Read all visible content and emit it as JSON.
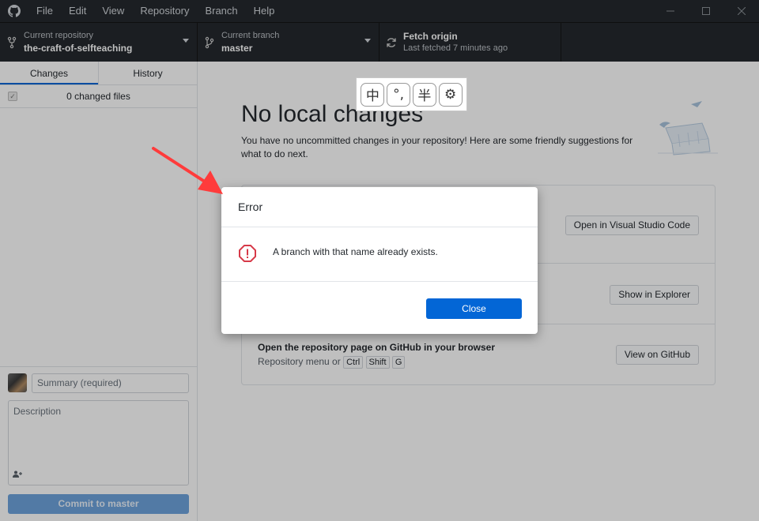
{
  "titlebar": {
    "menu": [
      "File",
      "Edit",
      "View",
      "Repository",
      "Branch",
      "Help"
    ]
  },
  "toolbar": {
    "repo": {
      "label": "Current repository",
      "value": "the-craft-of-selfteaching"
    },
    "branch": {
      "label": "Current branch",
      "value": "master"
    },
    "fetch": {
      "label": "Fetch origin",
      "value": "Last fetched 7 minutes ago"
    }
  },
  "sidebar": {
    "tabs": [
      "Changes",
      "History"
    ],
    "changed_files": "0 changed files",
    "summary_placeholder": "Summary (required)",
    "description_placeholder": "Description",
    "commit_button": "Commit to master"
  },
  "main": {
    "title": "No local changes",
    "subtitle": "You have no uncommitted changes in your repository! Here are some friendly suggestions for what to do next.",
    "suggestions": [
      {
        "button": "Open in Visual Studio Code"
      },
      {
        "button": "Show in Explorer"
      },
      {
        "title": "Open the repository page on GitHub in your browser",
        "desc_prefix": "Repository menu or",
        "keys": [
          "Ctrl",
          "Shift",
          "G"
        ],
        "button": "View on GitHub"
      }
    ]
  },
  "ime": {
    "buttons": [
      "中",
      "°,",
      "半",
      "⚙"
    ]
  },
  "dialog": {
    "title": "Error",
    "message": "A branch with that name already exists.",
    "close_button": "Close"
  }
}
